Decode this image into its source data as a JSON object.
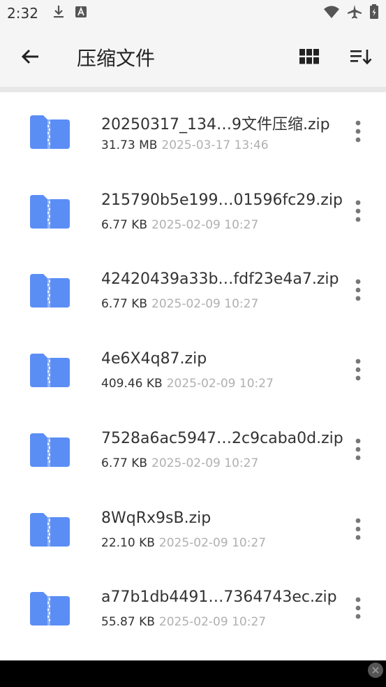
{
  "status": {
    "time": "2:32",
    "left_icons": [
      "download-icon",
      "a-letter-icon"
    ],
    "right_icons": [
      "wifi-icon",
      "airplane-icon",
      "battery-icon"
    ]
  },
  "toolbar": {
    "title": "压缩文件",
    "back_icon": "arrow-left-icon",
    "grid_icon": "grid-view-icon",
    "sort_icon": "sort-icon"
  },
  "files": [
    {
      "name": "20250317_134…9文件压缩.zip",
      "size": "31.73 MB",
      "date": "2025-03-17 13:46"
    },
    {
      "name": "215790b5e199…01596fc29.zip",
      "size": "6.77 KB",
      "date": "2025-02-09 10:27"
    },
    {
      "name": "42420439a33b…fdf23e4a7.zip",
      "size": "6.77 KB",
      "date": "2025-02-09 10:27"
    },
    {
      "name": "4e6X4q87.zip",
      "size": "409.46 KB",
      "date": "2025-02-09 10:27"
    },
    {
      "name": "7528a6ac5947…2c9caba0d.zip",
      "size": "6.77 KB",
      "date": "2025-02-09 10:27"
    },
    {
      "name": "8WqRx9sB.zip",
      "size": "22.10 KB",
      "date": "2025-02-09 10:27"
    },
    {
      "name": "a77b1db4491…7364743ec.zip",
      "size": "55.87 KB",
      "date": "2025-02-09 10:27"
    }
  ],
  "colors": {
    "folder": "#5b8ef5",
    "accent_dark": "#222222",
    "date_gray": "#b0b0b0"
  }
}
